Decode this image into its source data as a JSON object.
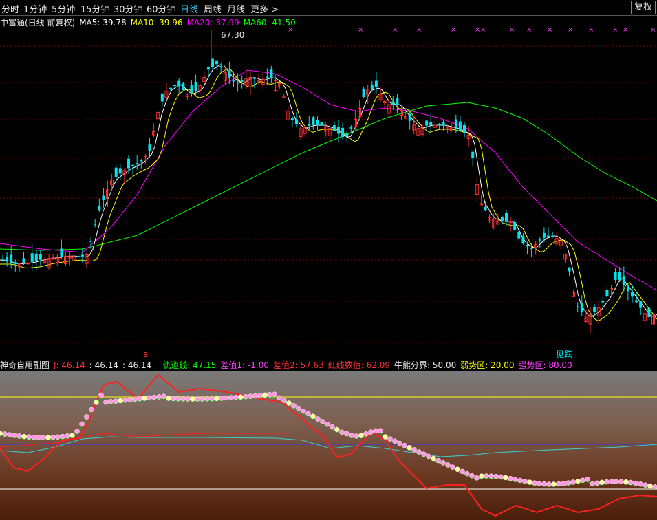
{
  "toolbar": {
    "tabs": [
      {
        "label": "分时",
        "active": false
      },
      {
        "label": "1分钟",
        "active": false
      },
      {
        "label": "5分钟",
        "active": false
      },
      {
        "label": "15分钟",
        "active": false
      },
      {
        "label": "30分钟",
        "active": false
      },
      {
        "label": "60分钟",
        "active": false
      },
      {
        "label": "日线",
        "active": true
      },
      {
        "label": "周线",
        "active": false
      },
      {
        "label": "月线",
        "active": false
      },
      {
        "label": "更多 >",
        "active": false
      }
    ],
    "fuquan_label": "复权"
  },
  "main_legend": {
    "title": "中富通(日线 前复权)",
    "ma5": "MA5: 39.78",
    "ma10": "MA10: 39.96",
    "ma20": "MA20: 37.99",
    "ma60": "MA60: 41.50"
  },
  "sub_legend": {
    "title": "神奇自用副图",
    "j": "J: 46.14",
    "v2": ": 46.14",
    "v3": ": 46.14",
    "track": "轨道线: 47.15",
    "diff1": "差值1: -1.00",
    "diff2": "差值2: 57.63",
    "red": "红线数值: 62.09",
    "bull": "牛熊分界: 50.00",
    "weak": "弱势区: 20.00",
    "strong": "强势区: 80.00"
  },
  "annotations": {
    "high_label": "67.30",
    "s_label": "s",
    "break_label": "见跌",
    "marker_x": "×",
    "marker_xx": "××"
  },
  "colors": {
    "up": "#ff3232",
    "down": "#00e5ee",
    "ma5": "#ffffff",
    "ma10": "#ffff00",
    "ma20": "#ff00ff",
    "ma60": "#00ff00",
    "grid": "#7a0000",
    "legend_title": "#e6e6e6",
    "sub_red": "#ff2020",
    "sub_cyan": "#3ad0d0",
    "strong": "#ff40ff",
    "weak": "#ffff00"
  },
  "chart_data": {
    "type": "candlestick",
    "price_high_label": 67.3,
    "ma_values": {
      "MA5": 39.78,
      "MA10": 39.96,
      "MA20": 37.99,
      "MA60": 41.5
    },
    "sub_indicator_values": {
      "J": 46.14,
      "track": 47.15,
      "diff1": -1.0,
      "diff2": 57.63,
      "red": 62.09,
      "bull_bear": 50.0,
      "weak": 20.0,
      "strong": 80.0
    }
  }
}
